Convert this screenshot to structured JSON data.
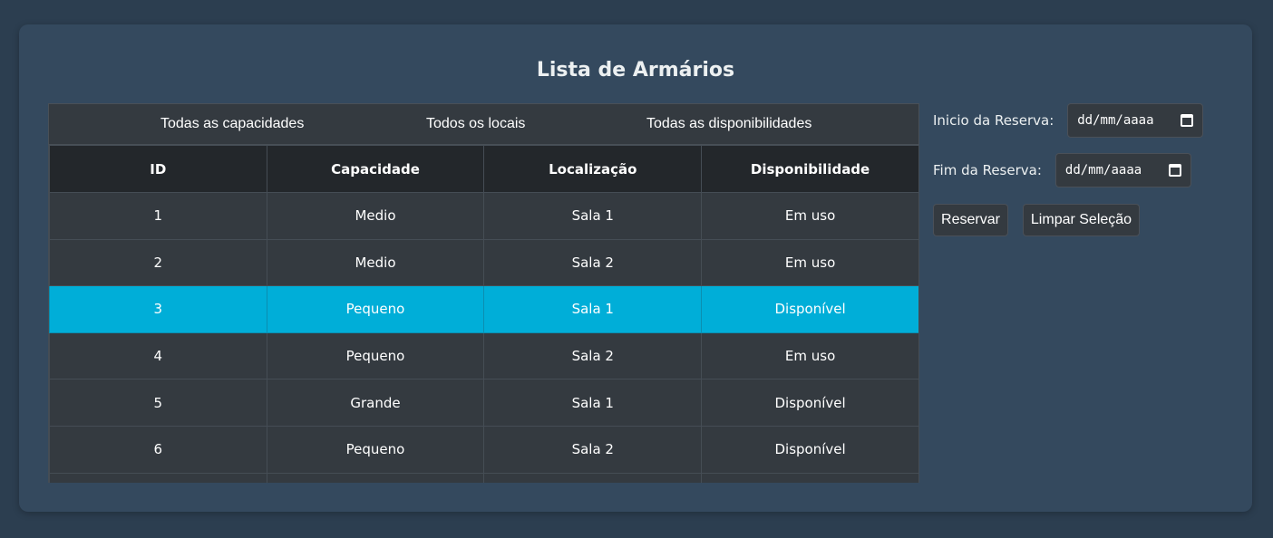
{
  "title": "Lista de Armários",
  "filters": {
    "capacity": "Todas as capacidades",
    "location": "Todos os locais",
    "availability": "Todas as disponibilidades"
  },
  "table": {
    "headers": [
      "ID",
      "Capacidade",
      "Localização",
      "Disponibilidade"
    ],
    "rows": [
      [
        "1",
        "Medio",
        "Sala 1",
        "Em uso"
      ],
      [
        "2",
        "Medio",
        "Sala 2",
        "Em uso"
      ],
      [
        "3",
        "Pequeno",
        "Sala 1",
        "Disponível"
      ],
      [
        "4",
        "Pequeno",
        "Sala 2",
        "Em uso"
      ],
      [
        "5",
        "Grande",
        "Sala 1",
        "Disponível"
      ],
      [
        "6",
        "Pequeno",
        "Sala 2",
        "Disponível"
      ]
    ],
    "selected_row_id": "3"
  },
  "reservation": {
    "start_label": "Inicio da Reserva:",
    "start_value": "dd/mm/aaaa",
    "end_label": "Fim da Reserva:",
    "end_value": "dd/mm/aaaa",
    "reserve_button": "Reservar",
    "clear_button": "Limpar Seleção"
  },
  "colors": {
    "page_bg": "#2c3e50",
    "card_bg": "#34495e",
    "table_bg": "#343a40",
    "header_bg": "#23272b",
    "selected_row": "#00aed8"
  }
}
